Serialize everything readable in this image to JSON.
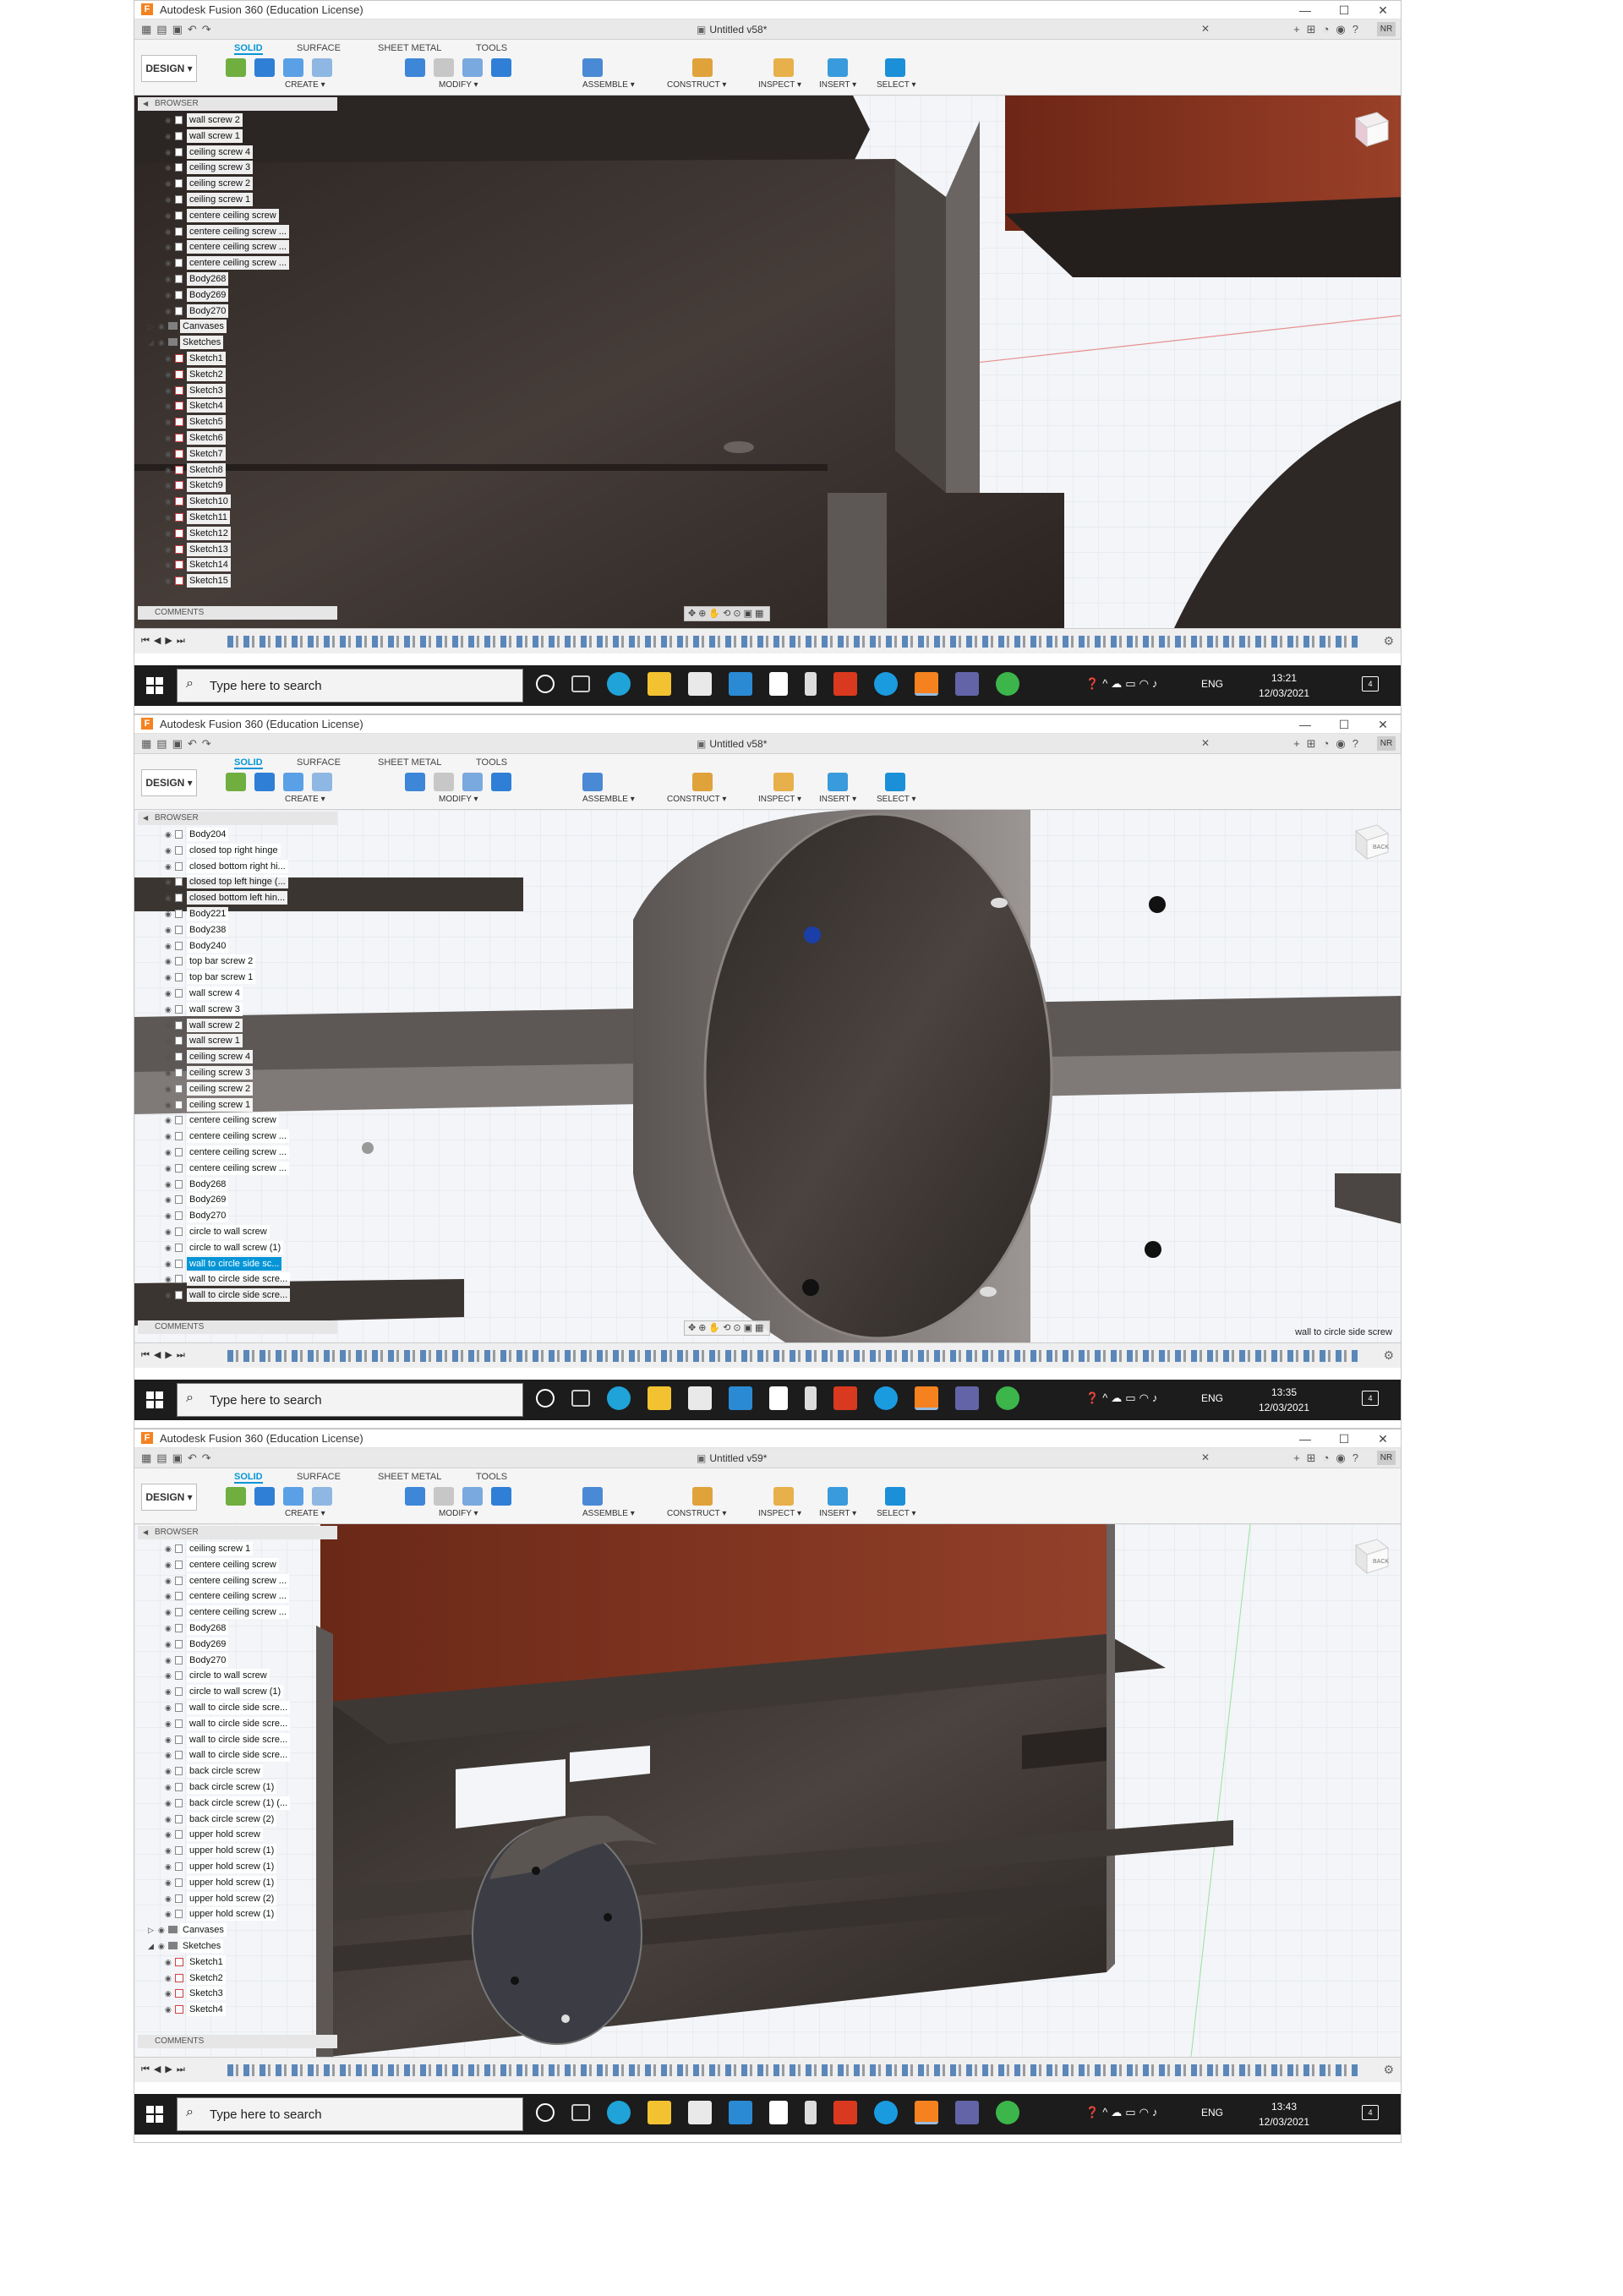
{
  "screenshots": [
    {
      "window_title": "Autodesk Fusion 360 (Education License)",
      "doc_title": "Untitled v58*",
      "user_initials": "NR",
      "design_label": "DESIGN ▾",
      "workspace_tabs": [
        "SOLID",
        "SURFACE",
        "SHEET METAL",
        "TOOLS"
      ],
      "group_labels": [
        "CREATE ▾",
        "MODIFY ▾",
        "ASSEMBLE ▾",
        "CONSTRUCT ▾",
        "INSPECT ▾",
        "INSERT ▾",
        "SELECT ▾"
      ],
      "browser_label": "BROWSER",
      "comments_label": "COMMENTS",
      "tree": [
        {
          "label": "wall screw 2",
          "kind": "body"
        },
        {
          "label": "wall screw 1",
          "kind": "body"
        },
        {
          "label": "ceiling screw 4",
          "kind": "body"
        },
        {
          "label": "ceiling screw 3",
          "kind": "body"
        },
        {
          "label": "ceiling screw 2",
          "kind": "body"
        },
        {
          "label": "ceiling screw 1",
          "kind": "body"
        },
        {
          "label": "centere ceiling screw",
          "kind": "body"
        },
        {
          "label": "centere ceiling screw ...",
          "kind": "body"
        },
        {
          "label": "centere ceiling screw ...",
          "kind": "body"
        },
        {
          "label": "centere ceiling screw ...",
          "kind": "body"
        },
        {
          "label": "Body268",
          "kind": "body"
        },
        {
          "label": "Body269",
          "kind": "body"
        },
        {
          "label": "Body270",
          "kind": "body"
        },
        {
          "label": "Canvases",
          "kind": "folder"
        },
        {
          "label": "Sketches",
          "kind": "folder-open"
        },
        {
          "label": "Sketch1",
          "kind": "sketch"
        },
        {
          "label": "Sketch2",
          "kind": "sketch"
        },
        {
          "label": "Sketch3",
          "kind": "sketch"
        },
        {
          "label": "Sketch4",
          "kind": "sketch"
        },
        {
          "label": "Sketch5",
          "kind": "sketch"
        },
        {
          "label": "Sketch6",
          "kind": "sketch"
        },
        {
          "label": "Sketch7",
          "kind": "sketch"
        },
        {
          "label": "Sketch8",
          "kind": "sketch"
        },
        {
          "label": "Sketch9",
          "kind": "sketch"
        },
        {
          "label": "Sketch10",
          "kind": "sketch"
        },
        {
          "label": "Sketch11",
          "kind": "sketch"
        },
        {
          "label": "Sketch12",
          "kind": "sketch"
        },
        {
          "label": "Sketch13",
          "kind": "sketch"
        },
        {
          "label": "Sketch14",
          "kind": "sketch"
        },
        {
          "label": "Sketch15",
          "kind": "sketch"
        }
      ],
      "status_text": "",
      "search_placeholder": "Type here to search",
      "lang": "ENG",
      "time": "13:21",
      "date": "12/03/2021",
      "notification_count": "4"
    },
    {
      "window_title": "Autodesk Fusion 360 (Education License)",
      "doc_title": "Untitled v58*",
      "user_initials": "NR",
      "design_label": "DESIGN ▾",
      "workspace_tabs": [
        "SOLID",
        "SURFACE",
        "SHEET METAL",
        "TOOLS"
      ],
      "group_labels": [
        "CREATE ▾",
        "MODIFY ▾",
        "ASSEMBLE ▾",
        "CONSTRUCT ▾",
        "INSPECT ▾",
        "INSERT ▾",
        "SELECT ▾"
      ],
      "browser_label": "BROWSER",
      "comments_label": "COMMENTS",
      "tree": [
        {
          "label": "Body204",
          "kind": "body"
        },
        {
          "label": "closed top right hinge",
          "kind": "body"
        },
        {
          "label": "closed bottom right hi...",
          "kind": "body"
        },
        {
          "label": "closed top left hinge (...",
          "kind": "body"
        },
        {
          "label": "closed bottom left hin...",
          "kind": "body"
        },
        {
          "label": "Body221",
          "kind": "body"
        },
        {
          "label": "Body238",
          "kind": "body"
        },
        {
          "label": "Body240",
          "kind": "body"
        },
        {
          "label": "top bar screw 2",
          "kind": "body"
        },
        {
          "label": "top bar screw 1",
          "kind": "body"
        },
        {
          "label": "wall screw 4",
          "kind": "body"
        },
        {
          "label": "wall screw 3",
          "kind": "body"
        },
        {
          "label": "wall screw 2",
          "kind": "body"
        },
        {
          "label": "wall screw 1",
          "kind": "body"
        },
        {
          "label": "ceiling screw 4",
          "kind": "body"
        },
        {
          "label": "ceiling screw 3",
          "kind": "body"
        },
        {
          "label": "ceiling screw 2",
          "kind": "body"
        },
        {
          "label": "ceiling screw 1",
          "kind": "body"
        },
        {
          "label": "centere ceiling screw",
          "kind": "body"
        },
        {
          "label": "centere ceiling screw ...",
          "kind": "body"
        },
        {
          "label": "centere ceiling screw ...",
          "kind": "body"
        },
        {
          "label": "centere ceiling screw ...",
          "kind": "body"
        },
        {
          "label": "Body268",
          "kind": "body"
        },
        {
          "label": "Body269",
          "kind": "body"
        },
        {
          "label": "Body270",
          "kind": "body"
        },
        {
          "label": "circle to wall screw",
          "kind": "body"
        },
        {
          "label": "circle to wall screw (1)",
          "kind": "body"
        },
        {
          "label": "wall to circle side sc...",
          "kind": "body-selected"
        },
        {
          "label": "wall to circle side scre...",
          "kind": "body"
        },
        {
          "label": "wall to circle side scre...",
          "kind": "body"
        }
      ],
      "status_text": "wall to circle side screw",
      "search_placeholder": "Type here to search",
      "lang": "ENG",
      "time": "13:35",
      "date": "12/03/2021",
      "notification_count": "4"
    },
    {
      "window_title": "Autodesk Fusion 360 (Education License)",
      "doc_title": "Untitled v59*",
      "user_initials": "NR",
      "design_label": "DESIGN ▾",
      "workspace_tabs": [
        "SOLID",
        "SURFACE",
        "SHEET METAL",
        "TOOLS"
      ],
      "group_labels": [
        "CREATE ▾",
        "MODIFY ▾",
        "ASSEMBLE ▾",
        "CONSTRUCT ▾",
        "INSPECT ▾",
        "INSERT ▾",
        "SELECT ▾"
      ],
      "browser_label": "BROWSER",
      "comments_label": "COMMENTS",
      "tree": [
        {
          "label": "ceiling screw 1",
          "kind": "body"
        },
        {
          "label": "centere ceiling screw",
          "kind": "body"
        },
        {
          "label": "centere ceiling screw ...",
          "kind": "body"
        },
        {
          "label": "centere ceiling screw ...",
          "kind": "body"
        },
        {
          "label": "centere ceiling screw ...",
          "kind": "body"
        },
        {
          "label": "Body268",
          "kind": "body"
        },
        {
          "label": "Body269",
          "kind": "body"
        },
        {
          "label": "Body270",
          "kind": "body"
        },
        {
          "label": "circle to wall screw",
          "kind": "body"
        },
        {
          "label": "circle to wall screw (1)",
          "kind": "body"
        },
        {
          "label": "wall to circle side scre...",
          "kind": "body"
        },
        {
          "label": "wall to circle side scre...",
          "kind": "body"
        },
        {
          "label": "wall to circle side scre...",
          "kind": "body"
        },
        {
          "label": "wall to circle side scre...",
          "kind": "body"
        },
        {
          "label": "back circle screw",
          "kind": "body"
        },
        {
          "label": "back circle screw (1)",
          "kind": "body"
        },
        {
          "label": "back circle screw (1) (...",
          "kind": "body"
        },
        {
          "label": "back circle screw (2)",
          "kind": "body"
        },
        {
          "label": "upper hold screw",
          "kind": "body"
        },
        {
          "label": "upper hold screw (1)",
          "kind": "body"
        },
        {
          "label": "upper hold screw (1)",
          "kind": "body"
        },
        {
          "label": "upper hold screw (1)",
          "kind": "body"
        },
        {
          "label": "upper hold screw (2)",
          "kind": "body"
        },
        {
          "label": "upper hold screw (1)",
          "kind": "body"
        },
        {
          "label": "Canvases",
          "kind": "folder"
        },
        {
          "label": "Sketches",
          "kind": "folder-open"
        },
        {
          "label": "Sketch1",
          "kind": "sketch"
        },
        {
          "label": "Sketch2",
          "kind": "sketch"
        },
        {
          "label": "Sketch3",
          "kind": "sketch"
        },
        {
          "label": "Sketch4",
          "kind": "sketch"
        }
      ],
      "status_text": "",
      "search_placeholder": "Type here to search",
      "lang": "ENG",
      "time": "13:43",
      "date": "12/03/2021",
      "notification_count": "4"
    }
  ],
  "icons": {
    "quick_access": [
      "grid-icon",
      "file-icon",
      "save-icon",
      "undo-icon",
      "redo-icon"
    ],
    "taskbar_apps": [
      "cortana-icon",
      "task-view-icon",
      "edge-icon",
      "file-explorer-icon",
      "store-icon",
      "mail-icon",
      "dropbox-icon",
      "autodesk-icon",
      "office-icon",
      "cura-icon",
      "fusion-icon",
      "teams-icon",
      "whatsapp-icon"
    ],
    "tray": [
      "help-icon",
      "chevron-up-icon",
      "cloud-icon",
      "battery-icon",
      "wifi-icon",
      "volume-icon"
    ]
  },
  "colors": {
    "accent": "#0696d7",
    "fusion_orange": "#f5821f",
    "taskbar": "#1c1c1c",
    "wood_dark": "#3a3330",
    "wood_red": "#7a2e1c",
    "grid": "#f4f6f8"
  }
}
